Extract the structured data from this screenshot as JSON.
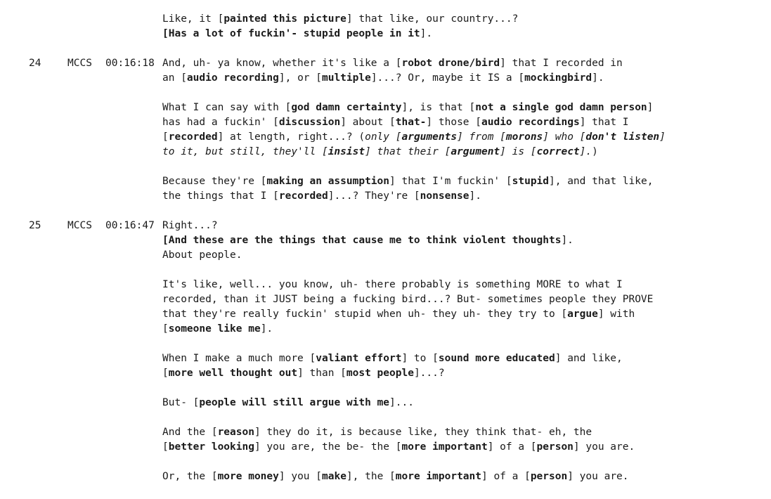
{
  "entries": [
    {
      "number": "",
      "speaker": "",
      "timestamp": "",
      "paragraphs": [
        [
          [
            [
              "Like, it [",
              "n"
            ],
            [
              "painted this picture",
              "b"
            ],
            [
              "] that like, our country...?",
              "n"
            ]
          ],
          [
            [
              "[Has a lot of fuckin'- stupid people in it",
              "b"
            ],
            [
              "].",
              "n"
            ]
          ]
        ]
      ]
    },
    {
      "number": "24",
      "speaker": "MCCS",
      "timestamp": "00:16:18",
      "paragraphs": [
        [
          [
            [
              "And, uh- ya know, whether it's like a [",
              "n"
            ],
            [
              "robot drone/bird",
              "b"
            ],
            [
              "] that I recorded in",
              "n"
            ]
          ],
          [
            [
              "an [",
              "n"
            ],
            [
              "audio recording",
              "b"
            ],
            [
              "], or [",
              "n"
            ],
            [
              "multiple",
              "b"
            ],
            [
              "]...? Or, maybe it IS a [",
              "n"
            ],
            [
              "mockingbird",
              "b"
            ],
            [
              "].",
              "n"
            ]
          ]
        ],
        [
          [
            [
              "What I can say with [",
              "n"
            ],
            [
              "god damn certainty",
              "b"
            ],
            [
              "], is that [",
              "n"
            ],
            [
              "not a single god damn person",
              "b"
            ],
            [
              "]",
              "n"
            ]
          ],
          [
            [
              "has had a fuckin' [",
              "n"
            ],
            [
              "discussion",
              "b"
            ],
            [
              "] about [",
              "n"
            ],
            [
              "that-",
              "b"
            ],
            [
              "] those [",
              "n"
            ],
            [
              "audio recordings",
              "b"
            ],
            [
              "] that I",
              "n"
            ]
          ],
          [
            [
              "[",
              "n"
            ],
            [
              "recorded",
              "b"
            ],
            [
              "] at length, right...? (",
              "n"
            ],
            [
              "only [",
              "i"
            ],
            [
              "arguments",
              "bi"
            ],
            [
              "] from [",
              "i"
            ],
            [
              "morons",
              "bi"
            ],
            [
              "] who [",
              "i"
            ],
            [
              "don't listen",
              "bi"
            ],
            [
              "]",
              "i"
            ]
          ],
          [
            [
              "to it, but still, they'll [",
              "i"
            ],
            [
              "insist",
              "bi"
            ],
            [
              "] that their [",
              "i"
            ],
            [
              "argument",
              "bi"
            ],
            [
              "] is [",
              "i"
            ],
            [
              "correct",
              "bi"
            ],
            [
              "].",
              "i"
            ],
            [
              ")",
              "n"
            ]
          ]
        ],
        [
          [
            [
              "Because they're [",
              "n"
            ],
            [
              "making an assumption",
              "b"
            ],
            [
              "] that I'm fuckin' [",
              "n"
            ],
            [
              "stupid",
              "b"
            ],
            [
              "], and that like,",
              "n"
            ]
          ],
          [
            [
              "the things that I [",
              "n"
            ],
            [
              "recorded",
              "b"
            ],
            [
              "]...? They're [",
              "n"
            ],
            [
              "nonsense",
              "b"
            ],
            [
              "].",
              "n"
            ]
          ]
        ]
      ]
    },
    {
      "number": "25",
      "speaker": "MCCS",
      "timestamp": "00:16:47",
      "paragraphs": [
        [
          [
            [
              "Right...?",
              "n"
            ]
          ],
          [
            [
              "[And these are the things that cause me to think violent thoughts",
              "b"
            ],
            [
              "].",
              "n"
            ]
          ],
          [
            [
              "About people.",
              "n"
            ]
          ]
        ],
        [
          [
            [
              "It's like, well... you know, uh- there probably is something MORE to what I",
              "n"
            ]
          ],
          [
            [
              "recorded, than it JUST being a fucking bird...? But- sometimes people they PROVE",
              "n"
            ]
          ],
          [
            [
              "that they're really fuckin' stupid when uh- they uh- they try to [",
              "n"
            ],
            [
              "argue",
              "b"
            ],
            [
              "] with",
              "n"
            ]
          ],
          [
            [
              "[",
              "n"
            ],
            [
              "someone like me",
              "b"
            ],
            [
              "].",
              "n"
            ]
          ]
        ],
        [
          [
            [
              "When I make a much more [",
              "n"
            ],
            [
              "valiant effort",
              "b"
            ],
            [
              "] to [",
              "n"
            ],
            [
              "sound more educated",
              "b"
            ],
            [
              "] and like,",
              "n"
            ]
          ],
          [
            [
              "[",
              "n"
            ],
            [
              "more well thought out",
              "b"
            ],
            [
              "] than [",
              "n"
            ],
            [
              "most people",
              "b"
            ],
            [
              "]...?",
              "n"
            ]
          ]
        ],
        [
          [
            [
              "But- [",
              "n"
            ],
            [
              "people will still argue with me",
              "b"
            ],
            [
              "]...",
              "n"
            ]
          ]
        ],
        [
          [
            [
              "And the [",
              "n"
            ],
            [
              "reason",
              "b"
            ],
            [
              "] they do it, is because like, they think that- eh, the",
              "n"
            ]
          ],
          [
            [
              "[",
              "n"
            ],
            [
              "better looking",
              "b"
            ],
            [
              "] you are, the be- the [",
              "n"
            ],
            [
              "more important",
              "b"
            ],
            [
              "] of a [",
              "n"
            ],
            [
              "person",
              "b"
            ],
            [
              "] you are.",
              "n"
            ]
          ]
        ],
        [
          [
            [
              "Or, the [",
              "n"
            ],
            [
              "more money",
              "b"
            ],
            [
              "] you [",
              "n"
            ],
            [
              "make",
              "b"
            ],
            [
              "], the [",
              "n"
            ],
            [
              "more important",
              "b"
            ],
            [
              "] of a [",
              "n"
            ],
            [
              "person",
              "b"
            ],
            [
              "] you are.",
              "n"
            ]
          ]
        ]
      ]
    }
  ]
}
